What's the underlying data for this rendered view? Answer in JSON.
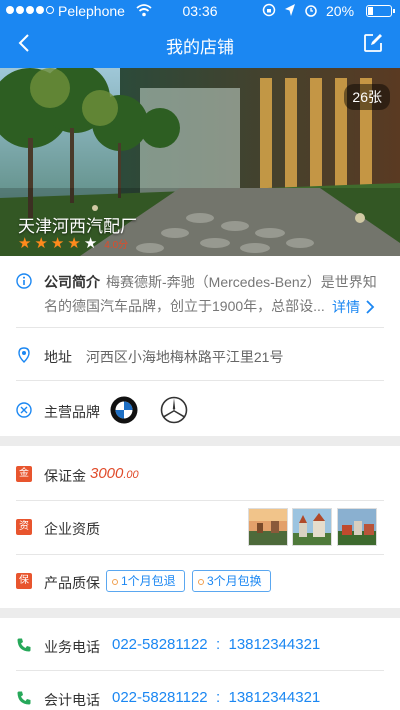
{
  "status_bar": {
    "carrier": "Pelephone",
    "time": "03:36",
    "battery": "20%",
    "battery_level": 0.2
  },
  "nav": {
    "title": "我的店铺",
    "back_icon": "chevron-left-icon",
    "edit_icon": "edit-icon"
  },
  "store": {
    "photo_count": "26张",
    "name": "天津河西汽配厂",
    "rating": 4,
    "rating_max": 5,
    "score_text": "4.0分"
  },
  "intro": {
    "label": "公司简介",
    "text": "梅赛德斯-奔驰（Mercedes-Benz）是世界知名的德国汽车品牌，创立于1900年，总部设...",
    "detail_label": "详情"
  },
  "address": {
    "label": "地址",
    "value": "河西区小海地梅林路平江里21号"
  },
  "brands": {
    "label": "主营品牌",
    "items": [
      "bmw-logo",
      "mercedes-logo"
    ]
  },
  "deposit": {
    "label": "保证金",
    "value": "3000",
    "decimal": ".00",
    "icon_text": "金"
  },
  "qualification": {
    "label": "企业资质",
    "icon_text": "资"
  },
  "warranty": {
    "label": "产品质保",
    "icon_text": "保",
    "tags": [
      "1个月包退",
      "3个月包换"
    ]
  },
  "contacts": [
    {
      "label": "业务电话",
      "phone1": "022-58281122",
      "phone2": "13812344321"
    },
    {
      "label": "会计电话",
      "phone1": "022-58281122",
      "phone2": "13812344321"
    }
  ],
  "colors": {
    "accent": "#1b87f2",
    "star": "#ff8a1c",
    "price": "#e04b2a",
    "badge": "#e8552e",
    "phone_icon": "#27a85a"
  }
}
